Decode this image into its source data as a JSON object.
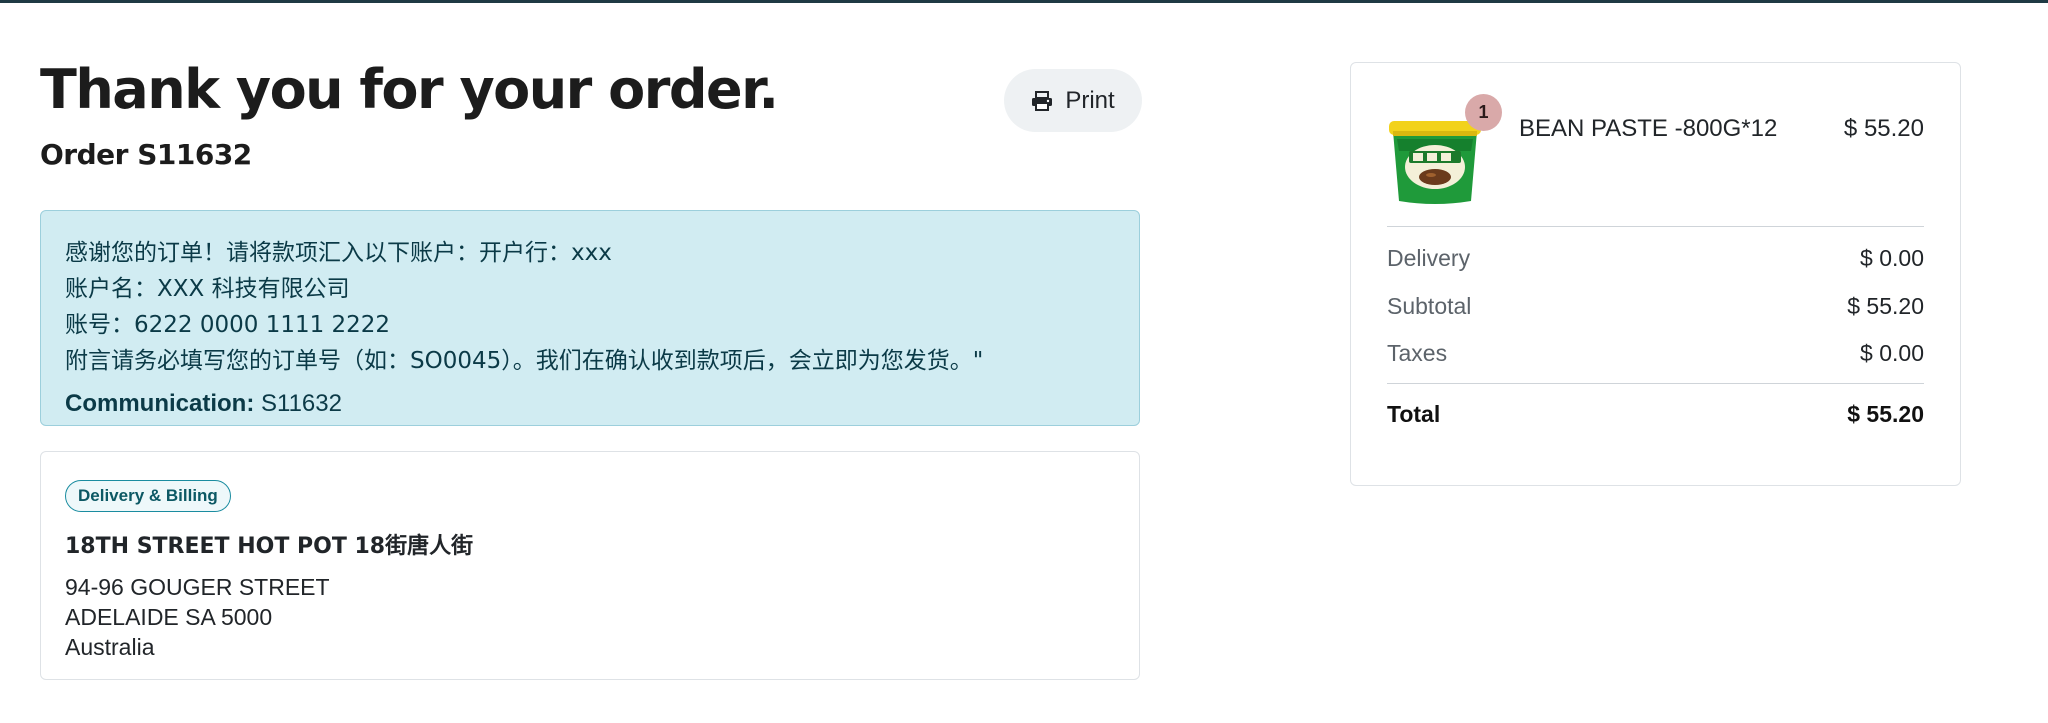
{
  "header": {
    "title": "Thank you for your order.",
    "order_label": "Order S11632",
    "print_label": "Print"
  },
  "bank_info": {
    "lines": [
      "感谢您的订单！请将款项汇入以下账户：开户行：xxx",
      "账户名：XXX 科技有限公司",
      "账号：6222 0000 1111 2222",
      "附言请务必填写您的订单号（如：SO0045）。我们在确认收到款项后，会立即为您发货。\""
    ],
    "communication_label": "Communication:",
    "communication_value": "S11632"
  },
  "address": {
    "badge": "Delivery & Billing",
    "name": "18TH STREET HOT POT 18街唐人街",
    "lines": [
      "94-96 GOUGER STREET",
      "ADELAIDE SA 5000",
      "Australia"
    ]
  },
  "summary": {
    "item": {
      "quantity": "1",
      "name": "BEAN PASTE -800G*12",
      "price": "$ 55.20",
      "image_icon": "bean-paste-tub-icon"
    },
    "rows": [
      {
        "label": "Delivery",
        "value": "$ 0.00"
      },
      {
        "label": "Subtotal",
        "value": "$ 55.20"
      },
      {
        "label": "Taxes",
        "value": "$ 0.00"
      }
    ],
    "total": {
      "label": "Total",
      "value": "$ 55.20"
    }
  },
  "colors": {
    "info_background": "#d1ecf2",
    "badge_border": "#1a8ca0",
    "qty_badge": "#d9a9a9",
    "product_green": "#1f9a3a",
    "product_lid": "#f2d21b"
  }
}
